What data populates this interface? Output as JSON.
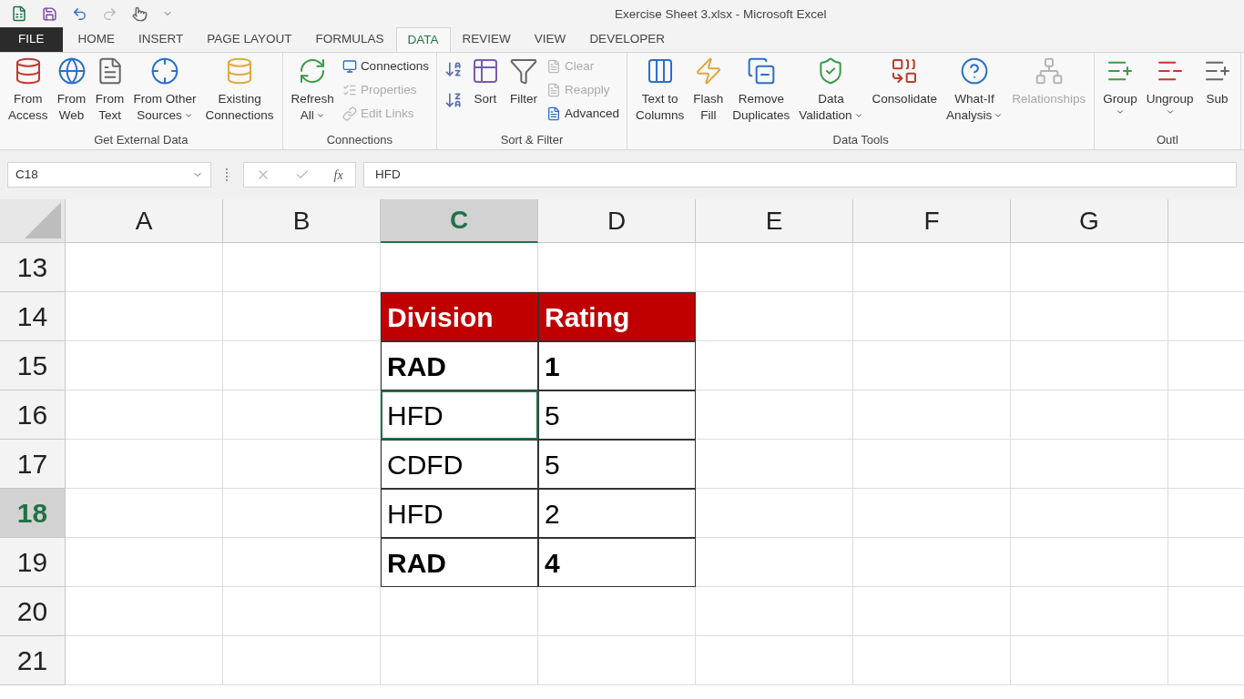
{
  "window": {
    "title": "Exercise Sheet 3.xlsx - Microsoft Excel"
  },
  "tabs": [
    {
      "label": "FILE",
      "kind": "file",
      "selected": false
    },
    {
      "label": "HOME",
      "kind": "tab",
      "selected": false
    },
    {
      "label": "INSERT",
      "kind": "tab",
      "selected": false
    },
    {
      "label": "PAGE LAYOUT",
      "kind": "tab",
      "selected": false
    },
    {
      "label": "FORMULAS",
      "kind": "tab",
      "selected": false
    },
    {
      "label": "DATA",
      "kind": "tab",
      "selected": true
    },
    {
      "label": "REVIEW",
      "kind": "tab",
      "selected": false
    },
    {
      "label": "VIEW",
      "kind": "tab",
      "selected": false
    },
    {
      "label": "DEVELOPER",
      "kind": "tab",
      "selected": false
    }
  ],
  "ribbon": [
    {
      "label": "Get External Data",
      "items": [
        {
          "kind": "large",
          "lines": [
            "From",
            "Access"
          ],
          "dropdown": false,
          "disabled": false
        },
        {
          "kind": "large",
          "lines": [
            "From",
            "Web"
          ],
          "dropdown": false,
          "disabled": false
        },
        {
          "kind": "large",
          "lines": [
            "From",
            "Text"
          ],
          "dropdown": false,
          "disabled": false
        },
        {
          "kind": "large",
          "lines": [
            "From Other",
            "Sources"
          ],
          "dropdown": true,
          "disabled": false
        },
        {
          "kind": "large",
          "lines": [
            "Existing",
            "Connections"
          ],
          "dropdown": false,
          "disabled": false
        }
      ]
    },
    {
      "label": "Connections",
      "items": [
        {
          "kind": "large",
          "lines": [
            "Refresh",
            "All"
          ],
          "dropdown": true,
          "disabled": false
        },
        {
          "kind": "small",
          "labels": [
            "Connections",
            "Properties",
            "Edit Links"
          ],
          "disabled": [
            false,
            true,
            true
          ]
        }
      ]
    },
    {
      "label": "Sort & Filter",
      "items": [
        {
          "kind": "sort_icons"
        },
        {
          "kind": "large",
          "lines": [
            "Sort"
          ],
          "dropdown": false,
          "disabled": false
        },
        {
          "kind": "large",
          "lines": [
            "Filter"
          ],
          "dropdown": false,
          "disabled": false
        },
        {
          "kind": "small",
          "labels": [
            "Clear",
            "Reapply",
            "Advanced"
          ],
          "disabled": [
            true,
            true,
            false
          ]
        }
      ]
    },
    {
      "label": "Data Tools",
      "items": [
        {
          "kind": "large",
          "lines": [
            "Text to",
            "Columns"
          ],
          "dropdown": false,
          "disabled": false
        },
        {
          "kind": "large",
          "lines": [
            "Flash",
            "Fill"
          ],
          "dropdown": false,
          "disabled": false
        },
        {
          "kind": "large",
          "lines": [
            "Remove",
            "Duplicates"
          ],
          "dropdown": false,
          "disabled": false
        },
        {
          "kind": "large",
          "lines": [
            "Data",
            "Validation"
          ],
          "dropdown": true,
          "disabled": false
        },
        {
          "kind": "large",
          "lines": [
            "Consolidate"
          ],
          "dropdown": false,
          "disabled": false
        },
        {
          "kind": "large",
          "lines": [
            "What-If",
            "Analysis"
          ],
          "dropdown": true,
          "disabled": false
        },
        {
          "kind": "large",
          "lines": [
            "Relationships"
          ],
          "dropdown": false,
          "disabled": true
        }
      ]
    },
    {
      "label": "Outl",
      "items": [
        {
          "kind": "large",
          "lines": [
            "Group"
          ],
          "dropdown": true,
          "disabled": false
        },
        {
          "kind": "large",
          "lines": [
            "Ungroup"
          ],
          "dropdown": true,
          "disabled": false
        },
        {
          "kind": "large",
          "lines": [
            "Sub"
          ],
          "dropdown": false,
          "disabled": false
        }
      ]
    }
  ],
  "formula_bar": {
    "name_box": "C18",
    "function_label": "fx",
    "value": "HFD"
  },
  "sheet": {
    "columns": [
      {
        "label": "A",
        "selected": false
      },
      {
        "label": "B",
        "selected": false
      },
      {
        "label": "C",
        "selected": true
      },
      {
        "label": "D",
        "selected": false
      },
      {
        "label": "E",
        "selected": false
      },
      {
        "label": "F",
        "selected": false
      },
      {
        "label": "G",
        "selected": false
      }
    ],
    "rows": [
      {
        "label": "13",
        "selected": false
      },
      {
        "label": "14",
        "selected": false
      },
      {
        "label": "15",
        "selected": false
      },
      {
        "label": "16",
        "selected": false
      },
      {
        "label": "17",
        "selected": false
      },
      {
        "label": "18",
        "selected": true
      },
      {
        "label": "19",
        "selected": false
      },
      {
        "label": "20",
        "selected": false
      },
      {
        "label": "21",
        "selected": false
      }
    ],
    "table": {
      "header": [
        "Division",
        "Rating"
      ],
      "rows": [
        {
          "cells": [
            "RAD",
            "1"
          ],
          "bold": true,
          "selected": false
        },
        {
          "cells": [
            "HFD",
            "5"
          ],
          "bold": false,
          "selected": true
        },
        {
          "cells": [
            "CDFD",
            "5"
          ],
          "bold": false,
          "selected": false
        },
        {
          "cells": [
            "HFD",
            "2"
          ],
          "bold": false,
          "selected": false
        },
        {
          "cells": [
            "RAD",
            "4"
          ],
          "bold": true,
          "selected": false
        }
      ]
    }
  }
}
